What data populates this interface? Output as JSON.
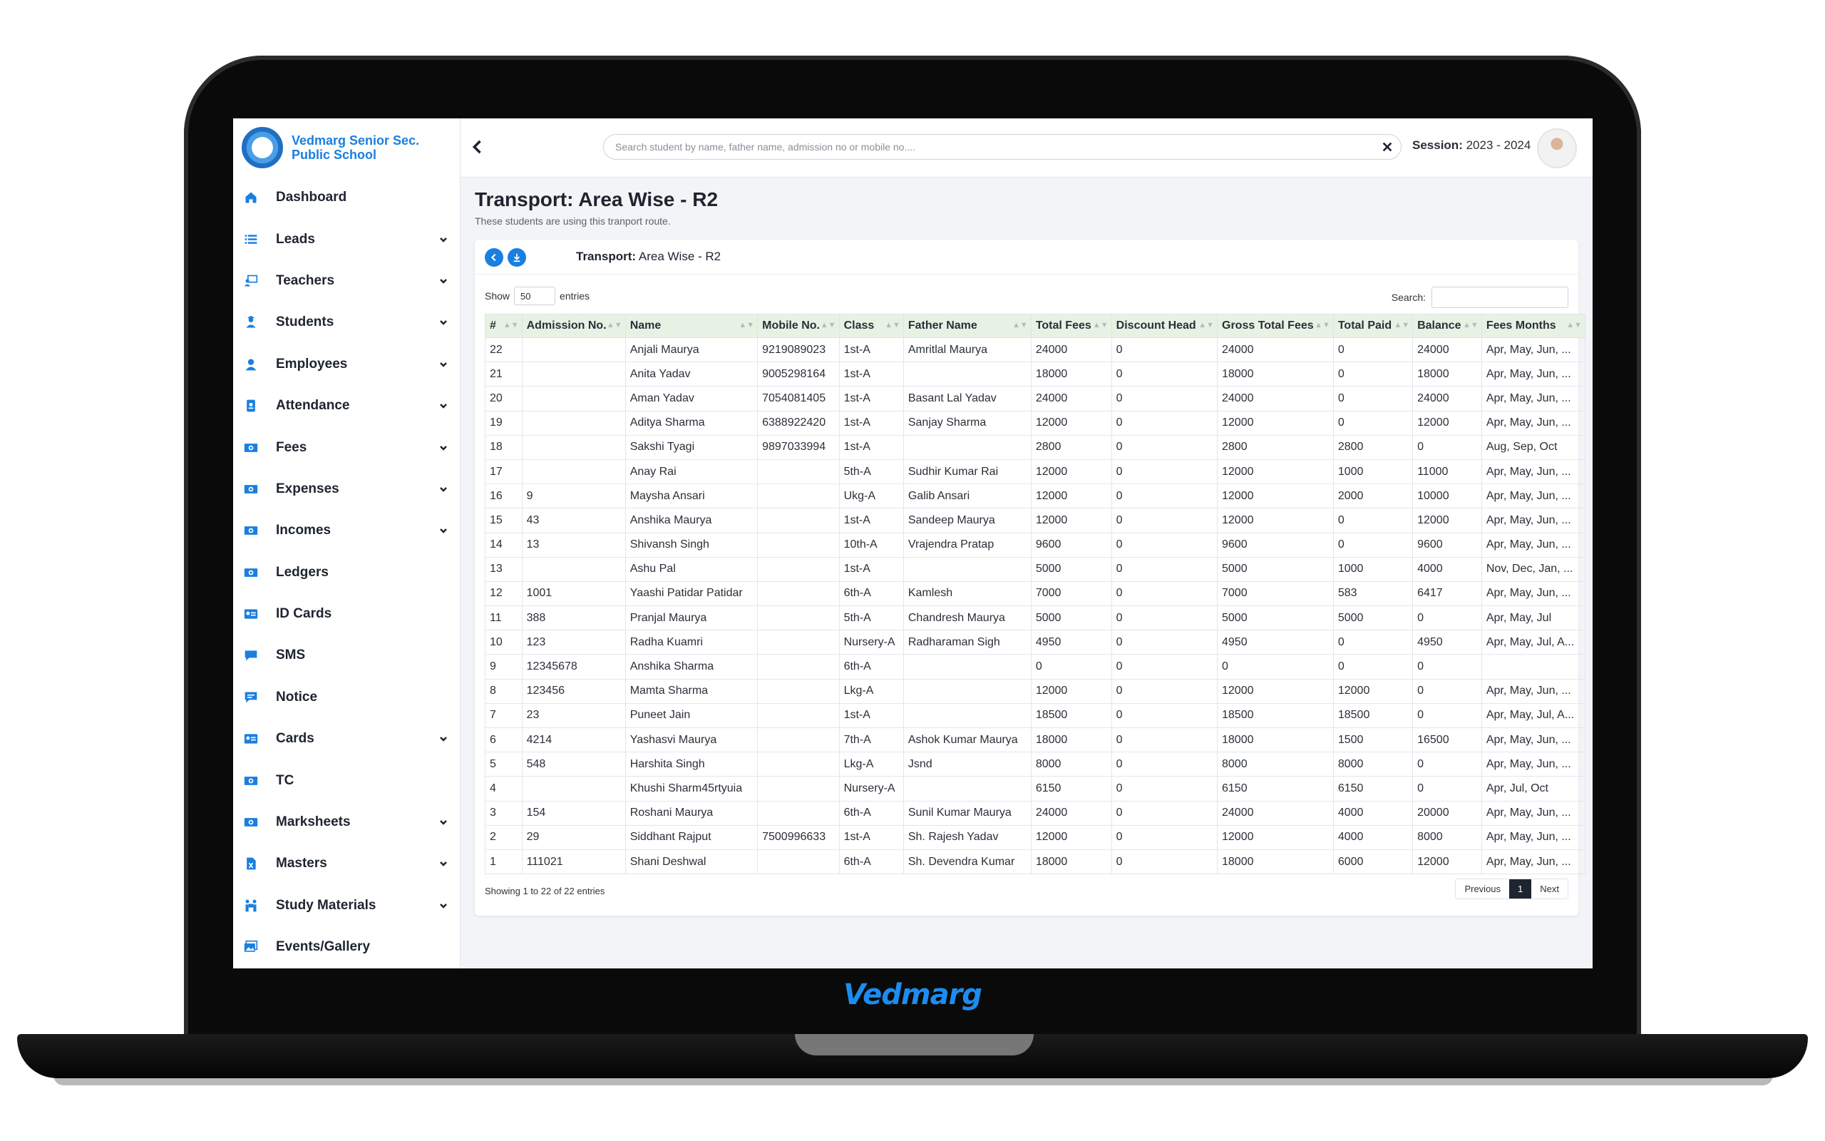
{
  "brand": "Vedmarg",
  "school": {
    "name": "Vedmarg Senior Sec. Public School"
  },
  "sidebar": {
    "items": [
      {
        "label": "Dashboard",
        "icon": "home-icon",
        "has_children": false
      },
      {
        "label": "Leads",
        "icon": "list-icon",
        "has_children": true
      },
      {
        "label": "Teachers",
        "icon": "chalkboard-teacher-icon",
        "has_children": true
      },
      {
        "label": "Students",
        "icon": "student-icon",
        "has_children": true
      },
      {
        "label": "Employees",
        "icon": "user-icon",
        "has_children": true
      },
      {
        "label": "Attendance",
        "icon": "id-badge-icon",
        "has_children": true
      },
      {
        "label": "Fees",
        "icon": "money-icon",
        "has_children": true
      },
      {
        "label": "Expenses",
        "icon": "money-icon",
        "has_children": true
      },
      {
        "label": "Incomes",
        "icon": "money-icon",
        "has_children": true
      },
      {
        "label": "Ledgers",
        "icon": "money-icon",
        "has_children": false
      },
      {
        "label": "ID Cards",
        "icon": "id-card-icon",
        "has_children": false
      },
      {
        "label": "SMS",
        "icon": "chat-icon",
        "has_children": false
      },
      {
        "label": "Notice",
        "icon": "message-icon",
        "has_children": false
      },
      {
        "label": "Cards",
        "icon": "id-card-icon",
        "has_children": true
      },
      {
        "label": "TC",
        "icon": "money-icon",
        "has_children": false
      },
      {
        "label": "Marksheets",
        "icon": "money-icon",
        "has_children": true
      },
      {
        "label": "Masters",
        "icon": "file-excel-icon",
        "has_children": true
      },
      {
        "label": "Study Materials",
        "icon": "people-carry-icon",
        "has_children": true
      },
      {
        "label": "Events/Gallery",
        "icon": "images-icon",
        "has_children": false
      }
    ]
  },
  "topbar": {
    "search_placeholder": "Search student by name, father name, admission no or mobile no....",
    "session_label": "Session:",
    "session_value": "2023 - 2024"
  },
  "page": {
    "title": "Transport: Area Wise - R2",
    "subtitle": "These students are using this tranport route."
  },
  "card": {
    "title_bold": "Transport:",
    "title_rest": "Area Wise - R2"
  },
  "datatable": {
    "show_label": "Show",
    "entries_label": "entries",
    "length_value": "50",
    "search_label": "Search:",
    "info": "Showing 1 to 22 of 22 entries",
    "pagination": {
      "previous": "Previous",
      "current": "1",
      "next": "Next"
    },
    "columns": [
      "#",
      "Admission No.",
      "Name",
      "Mobile No.",
      "Class",
      "Father Name",
      "Total Fees",
      "Discount Head",
      "Gross Total Fees",
      "Total Paid",
      "Balance",
      "Fees Months"
    ],
    "rows": [
      [
        "22",
        "",
        "Anjali Maurya",
        "9219089023",
        "1st-A",
        "Amritlal Maurya",
        "24000",
        "0",
        "24000",
        "0",
        "24000",
        "Apr, May, Jun, ..."
      ],
      [
        "21",
        "",
        "Anita Yadav",
        "9005298164",
        "1st-A",
        "",
        "18000",
        "0",
        "18000",
        "0",
        "18000",
        "Apr, May, Jun, ..."
      ],
      [
        "20",
        "",
        "Aman Yadav",
        "7054081405",
        "1st-A",
        "Basant Lal Yadav",
        "24000",
        "0",
        "24000",
        "0",
        "24000",
        "Apr, May, Jun, ..."
      ],
      [
        "19",
        "",
        "Aditya Sharma",
        "6388922420",
        "1st-A",
        "Sanjay Sharma",
        "12000",
        "0",
        "12000",
        "0",
        "12000",
        "Apr, May, Jun, ..."
      ],
      [
        "18",
        "",
        "Sakshi Tyagi",
        "9897033994",
        "1st-A",
        "",
        "2800",
        "0",
        "2800",
        "2800",
        "0",
        "Aug, Sep, Oct"
      ],
      [
        "17",
        "",
        "Anay Rai",
        "",
        "5th-A",
        "Sudhir Kumar Rai",
        "12000",
        "0",
        "12000",
        "1000",
        "11000",
        "Apr, May, Jun, ..."
      ],
      [
        "16",
        "9",
        "Maysha Ansari",
        "",
        "Ukg-A",
        "Galib Ansari",
        "12000",
        "0",
        "12000",
        "2000",
        "10000",
        "Apr, May, Jun, ..."
      ],
      [
        "15",
        "43",
        "Anshika Maurya",
        "",
        "1st-A",
        "Sandeep Maurya",
        "12000",
        "0",
        "12000",
        "0",
        "12000",
        "Apr, May, Jun, ..."
      ],
      [
        "14",
        "13",
        "Shivansh Singh",
        "",
        "10th-A",
        "Vrajendra Pratap",
        "9600",
        "0",
        "9600",
        "0",
        "9600",
        "Apr, May, Jun, ..."
      ],
      [
        "13",
        "",
        "Ashu Pal",
        "",
        "1st-A",
        "",
        "5000",
        "0",
        "5000",
        "1000",
        "4000",
        "Nov, Dec, Jan, ..."
      ],
      [
        "12",
        "1001",
        "Yaashi Patidar Patidar",
        "",
        "6th-A",
        "Kamlesh",
        "7000",
        "0",
        "7000",
        "583",
        "6417",
        "Apr, May, Jun, ..."
      ],
      [
        "11",
        "388",
        "Pranjal Maurya",
        "",
        "5th-A",
        "Chandresh Maurya",
        "5000",
        "0",
        "5000",
        "5000",
        "0",
        "Apr, May, Jul"
      ],
      [
        "10",
        "123",
        "Radha Kuamri",
        "",
        "Nursery-A",
        "Radharaman Sigh",
        "4950",
        "0",
        "4950",
        "0",
        "4950",
        "Apr, May, Jul, A..."
      ],
      [
        "9",
        "12345678",
        "Anshika Sharma",
        "",
        "6th-A",
        "",
        "0",
        "0",
        "0",
        "0",
        "0",
        ""
      ],
      [
        "8",
        "123456",
        "Mamta Sharma",
        "",
        "Lkg-A",
        "",
        "12000",
        "0",
        "12000",
        "12000",
        "0",
        "Apr, May, Jun, ..."
      ],
      [
        "7",
        "23",
        "Puneet Jain",
        "",
        "1st-A",
        "",
        "18500",
        "0",
        "18500",
        "18500",
        "0",
        "Apr, May, Jul, A..."
      ],
      [
        "6",
        "4214",
        "Yashasvi Maurya",
        "",
        "7th-A",
        "Ashok Kumar Maurya",
        "18000",
        "0",
        "18000",
        "1500",
        "16500",
        "Apr, May, Jun, ..."
      ],
      [
        "5",
        "548",
        "Harshita Singh",
        "",
        "Lkg-A",
        "Jsnd",
        "8000",
        "0",
        "8000",
        "8000",
        "0",
        "Apr, May, Jun, ..."
      ],
      [
        "4",
        "",
        "Khushi Sharm45rtyuia",
        "",
        "Nursery-A",
        "",
        "6150",
        "0",
        "6150",
        "6150",
        "0",
        "Apr, Jul, Oct"
      ],
      [
        "3",
        "154",
        "Roshani Maurya",
        "",
        "6th-A",
        "Sunil Kumar Maurya",
        "24000",
        "0",
        "24000",
        "4000",
        "20000",
        "Apr, May, Jun, ..."
      ],
      [
        "2",
        "29",
        "Siddhant Rajput",
        "7500996633",
        "1st-A",
        "Sh. Rajesh Yadav",
        "12000",
        "0",
        "12000",
        "4000",
        "8000",
        "Apr, May, Jun, ..."
      ],
      [
        "1",
        "111021",
        "Shani Deshwal",
        "",
        "6th-A",
        "Sh. Devendra Kumar",
        "18000",
        "0",
        "18000",
        "6000",
        "12000",
        "Apr, May, Jun, ..."
      ]
    ]
  },
  "colors": {
    "accent": "#1a7fe0",
    "header_bg": "#e8f2e4",
    "active_page": "#1e2430"
  }
}
